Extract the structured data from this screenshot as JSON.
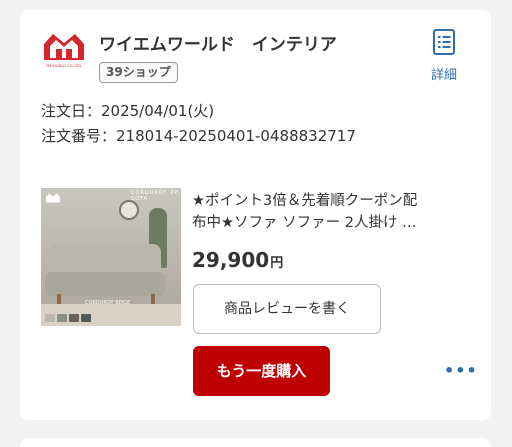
{
  "shop": {
    "name": "ワイエムワールド　インテリア",
    "badge": "39ショップ",
    "logo_text": "YM WORLD CO.,LTD.",
    "detail_label": "詳細"
  },
  "order": {
    "date_line": "注文日：2025/04/01(火)",
    "number_line": "注文番号：218014-20250401-0488832717"
  },
  "product": {
    "title_line1": "★ポイント3倍＆先着順クーポン配",
    "title_line2": "布中★ソファ ソファー 2人掛け …",
    "price": "29,900",
    "currency": "円",
    "image_caption_top": "CORDUROY 2P SOFA",
    "image_caption_bottom": "CORDUROY BEIGE"
  },
  "actions": {
    "review_label": "商品レビューを書く",
    "rebuy_label": "もう一度購入",
    "more_label": "•••"
  },
  "colors": {
    "accent_red": "#bf0000",
    "link_blue": "#2f6fb0",
    "logo_red": "#d6262d"
  },
  "icons": {
    "logo": "house-logo",
    "detail": "document-list-icon",
    "more": "more-dots-icon"
  }
}
